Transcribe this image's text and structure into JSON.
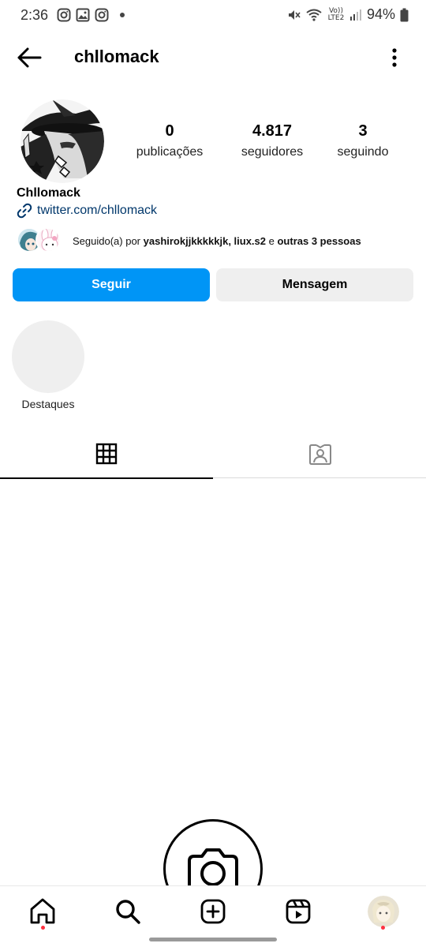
{
  "status_bar": {
    "time": "2:36",
    "battery": "94%",
    "network_label": "Vo)) LTE2",
    "icons": [
      "instagram-icon",
      "gallery-icon",
      "instagram-icon",
      "dot-icon",
      "mute-icon",
      "wifi-icon",
      "signal-icon",
      "battery-icon"
    ]
  },
  "header": {
    "username": "chllomack",
    "icons": [
      "back-arrow-icon",
      "more-vertical-icon"
    ]
  },
  "profile": {
    "stats": {
      "posts_value": "0",
      "posts_label": "publicações",
      "followers_value": "4.817",
      "followers_label": "seguidores",
      "following_value": "3",
      "following_label": "seguindo"
    },
    "display_name": "Chllomack",
    "link": "twitter.com/chllomack",
    "followed_by": {
      "prefix": "Seguido(a) por ",
      "users": "yashirokjjkkkkkjk, liux.s2",
      "connector": " e ",
      "others": "outras 3 pessoas"
    }
  },
  "actions": {
    "follow_label": "Seguir",
    "message_label": "Mensagem"
  },
  "highlights": {
    "label": "Destaques"
  },
  "tabs": [
    {
      "name": "grid",
      "icon": "grid-icon",
      "active": true
    },
    {
      "name": "tagged",
      "icon": "tagged-person-icon",
      "active": false
    }
  ],
  "bottom_nav": [
    {
      "name": "home",
      "icon": "home-icon"
    },
    {
      "name": "search",
      "icon": "search-icon"
    },
    {
      "name": "create",
      "icon": "plus-square-icon"
    },
    {
      "name": "reels",
      "icon": "reels-icon"
    },
    {
      "name": "profile",
      "icon": "profile-avatar"
    }
  ],
  "colors": {
    "follow_button": "#0095f6",
    "message_button": "#efefef",
    "link": "#00376b",
    "notification_dot": "#ff3040"
  }
}
